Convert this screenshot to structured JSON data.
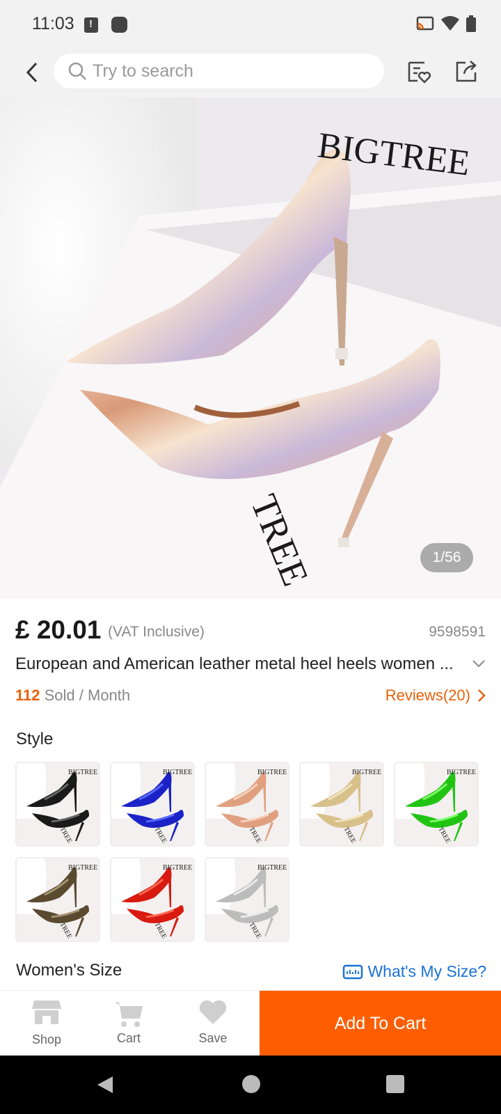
{
  "status_bar": {
    "time": "11:03"
  },
  "header": {
    "search_placeholder": "Try to search"
  },
  "hero": {
    "brand_top": "BIGTREE",
    "brand_bottom": "TREE",
    "counter": "1/56"
  },
  "product": {
    "price": "£ 20.01",
    "vat_note": "(VAT Inclusive)",
    "sku": "9598591",
    "title": "European and American leather metal heel heels women ...",
    "sold_count": "112",
    "sold_label": "Sold / Month",
    "reviews_label": "Reviews(20)"
  },
  "style_section": {
    "title": "Style",
    "options": [
      {
        "name": "black",
        "color": "#1a1a1a",
        "hi": "#666666"
      },
      {
        "name": "blue",
        "color": "#1a22c8",
        "hi": "#5a6aff"
      },
      {
        "name": "rose-gold",
        "color": "#e0a080",
        "hi": "#f6d2bb"
      },
      {
        "name": "gold",
        "color": "#d8c08a",
        "hi": "#f2e4bf"
      },
      {
        "name": "green",
        "color": "#22c414",
        "hi": "#7dff6a"
      },
      {
        "name": "bronze",
        "color": "#5a4a30",
        "hi": "#a69474"
      },
      {
        "name": "red",
        "color": "#d81a10",
        "hi": "#ff6a50"
      },
      {
        "name": "silver",
        "color": "#bcbcbc",
        "hi": "#eaeaea"
      }
    ]
  },
  "size_section": {
    "title": "Women's Size",
    "help_link": "What's My Size?"
  },
  "action_bar": {
    "shop_label": "Shop",
    "cart_label": "Cart",
    "save_label": "Save",
    "add_to_cart_label": "Add To Cart",
    "accent_color": "#fe5e00"
  }
}
